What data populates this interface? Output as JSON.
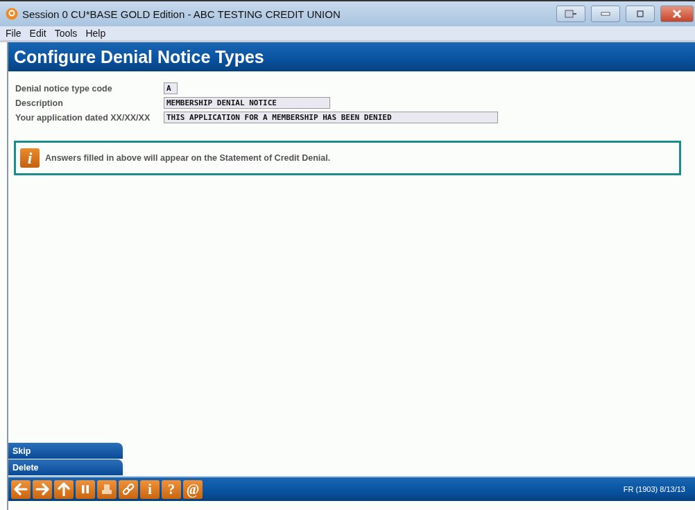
{
  "window": {
    "title": "Session 0 CU*BASE GOLD Edition - ABC TESTING CREDIT UNION"
  },
  "menu": [
    "File",
    "Edit",
    "Tools",
    "Help"
  ],
  "header": {
    "title": "Configure Denial Notice Types"
  },
  "fields": [
    {
      "label": "Denial notice type code",
      "value": "A",
      "kind": "short"
    },
    {
      "label": "Description",
      "value": "MEMBERSHIP DENIAL NOTICE",
      "kind": "medium"
    },
    {
      "label": "Your application dated XX/XX/XX",
      "value": "THIS APPLICATION FOR A MEMBERSHIP HAS BEEN DENIED",
      "kind": "long"
    }
  ],
  "info": {
    "icon": "i",
    "message": "Answers filled in above will appear on the Statement of Credit Denial."
  },
  "actions": [
    "Skip",
    "Delete"
  ],
  "toolbar": [
    {
      "kind": "back"
    },
    {
      "kind": "forward"
    },
    {
      "kind": "up"
    },
    {
      "kind": "pause"
    },
    {
      "kind": "print"
    },
    {
      "kind": "link"
    },
    {
      "kind": "text",
      "label": "i"
    },
    {
      "kind": "text",
      "label": "?"
    },
    {
      "kind": "text",
      "label": "@"
    }
  ],
  "status": "FR (1903) 8/13/13"
}
